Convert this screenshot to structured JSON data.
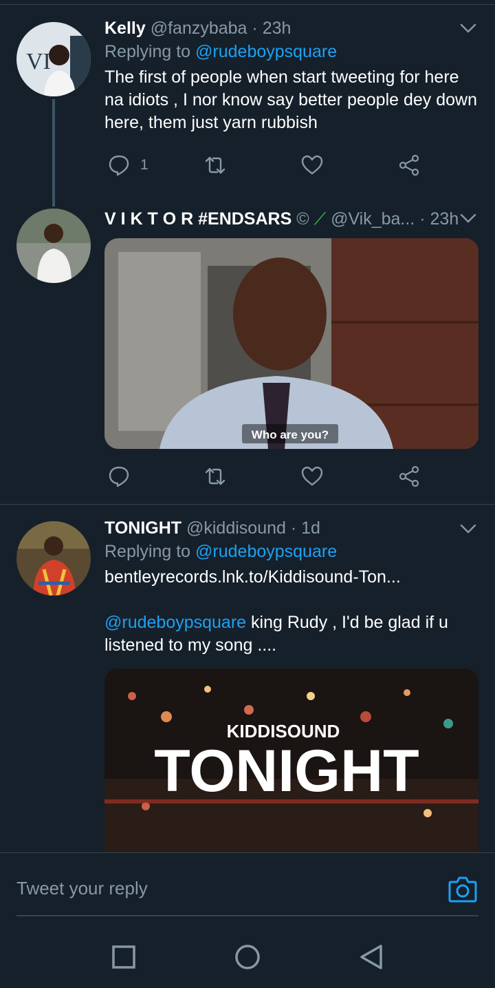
{
  "tweets": [
    {
      "name": "Kelly",
      "handle": "@fanzybaba",
      "time": "· 23h",
      "reply_label": "Replying to",
      "reply_to": "@rudeboypsquare",
      "text": "The first of people when start tweeting for here na idiots , I nor know say better people dey down here, them just yarn rubbish",
      "reply_count": "1"
    },
    {
      "name": "V I K T O R #ENDSARS",
      "handle": "@Vik_ba...",
      "time": "· 23h",
      "media_caption": "Who are you?"
    },
    {
      "name": "TONIGHT",
      "handle": "@kiddisound",
      "time": "· 1d",
      "reply_label": "Replying to",
      "reply_to": "@rudeboypsquare",
      "link": "bentleyrecords.lnk.to/Kiddisound-Ton...",
      "mention": "@rudeboypsquare",
      "text": " king Rudy , I'd be glad if u listened to my song ....",
      "media_artist": "KIDDISOUND",
      "media_title": "TONIGHT"
    }
  ],
  "compose": {
    "placeholder": "Tweet your reply"
  },
  "icons": {
    "reply": "reply-icon",
    "retweet": "retweet-icon",
    "like": "heart-icon",
    "share": "share-icon",
    "caret": "chevron-down-icon",
    "camera": "camera-icon"
  },
  "colors": {
    "background": "#15202b",
    "accent": "#1da1f2",
    "muted": "#8899a6",
    "divider": "#38444d"
  }
}
